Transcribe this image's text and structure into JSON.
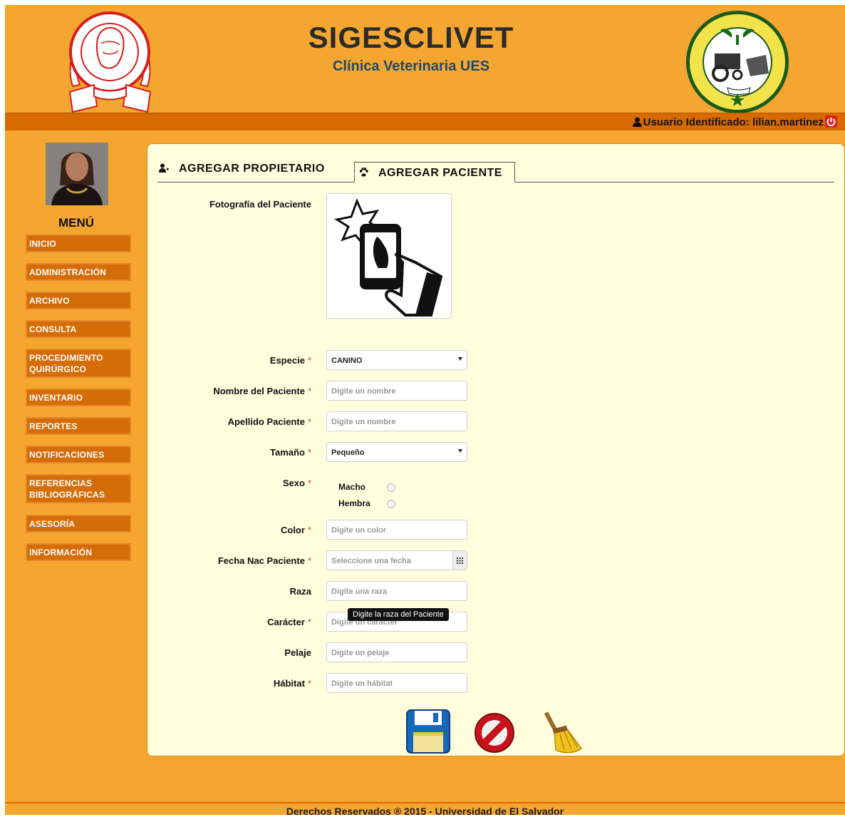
{
  "header": {
    "title": "SIGESCLIVET",
    "subtitle": "Clínica Veterinaria UES"
  },
  "userbar": {
    "user_text": "Usuario Identificado: lilian.martinez",
    "user_icon": "user-icon",
    "logout_icon": "power-icon"
  },
  "sidebar": {
    "menu_title": "MENÚ",
    "items": [
      {
        "label": "INICIO"
      },
      {
        "label": "ADMINISTRACIÓN"
      },
      {
        "label": "ARCHIVO"
      },
      {
        "label": "CONSULTA"
      },
      {
        "label": "PROCEDIMIENTO QUIRÚRGICO"
      },
      {
        "label": "INVENTARIO"
      },
      {
        "label": "REPORTES"
      },
      {
        "label": "NOTIFICACIONES"
      },
      {
        "label": "REFERENCIAS BIBLIOGRÁFICAS"
      },
      {
        "label": "ASESORÍA"
      },
      {
        "label": "INFORMACIÓN"
      }
    ]
  },
  "tabs": [
    {
      "label": "AGREGAR PROPIETARIO",
      "icon": "add-user-icon",
      "active": false
    },
    {
      "label": "AGREGAR PACIENTE",
      "icon": "paw-icon",
      "active": true
    }
  ],
  "form": {
    "photo_label": "Fotografía del Paciente",
    "especie": {
      "label": "Especie",
      "value": "CANINO"
    },
    "nombre": {
      "label": "Nombre del Paciente",
      "placeholder": "Digite un nombre"
    },
    "apellido": {
      "label": "Apellido Paciente",
      "placeholder": "Digite un nombre"
    },
    "tamano": {
      "label": "Tamaño",
      "value": "Pequeño"
    },
    "sexo": {
      "label": "Sexo",
      "options": [
        "Macho",
        "Hembra"
      ]
    },
    "color": {
      "label": "Color",
      "placeholder": "Digite un color"
    },
    "fecha": {
      "label": "Fecha Nac Paciente",
      "placeholder": "Seleccione una fecha"
    },
    "raza": {
      "label": "Raza",
      "placeholder": "Digite una raza"
    },
    "caracter": {
      "label": "Carácter",
      "placeholder": "Digite un carácter"
    },
    "pelaje": {
      "label": "Pelaje",
      "placeholder": "Digite un pelaje"
    },
    "habitat": {
      "label": "Hábitat",
      "placeholder": "Digite un hábitat"
    },
    "required_mark": "*",
    "tooltip": "Digite la raza del Paciente"
  },
  "actions": [
    {
      "icon": "save-icon"
    },
    {
      "icon": "cancel-icon"
    },
    {
      "icon": "broom-icon"
    }
  ],
  "footer": {
    "text": "Derechos Reservados ® 2015 - Universidad de El Salvador"
  },
  "colors": {
    "background": "#f5a630",
    "bar": "#d96a00",
    "menu_item": "#d46c07",
    "panel": "#ffffde"
  }
}
